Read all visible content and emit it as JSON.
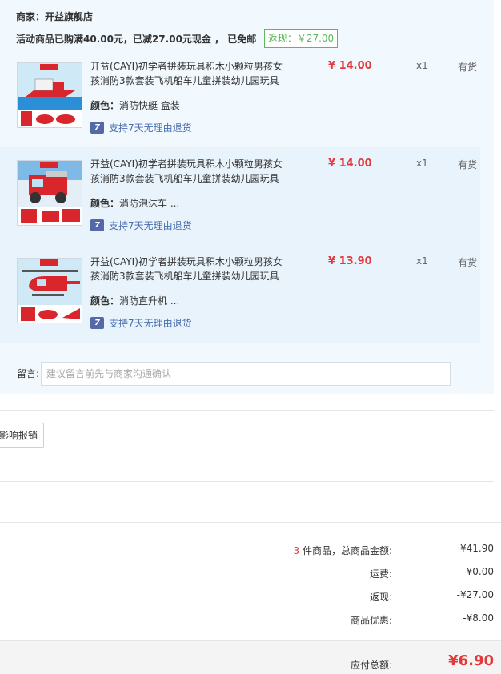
{
  "shop": {
    "name": "商家：开益旗舰店",
    "promo": "活动商品已购满40.00元，已减27.00元现金 ， 已免邮",
    "rebate_badge": "返现：￥27.00"
  },
  "items": [
    {
      "title": "开益(CAYI)初学者拼装玩具积木小颗粒男孩女孩消防3款套装飞机船车儿童拼装幼儿园玩具",
      "price": "¥ 14.00",
      "qty": "x1",
      "stock": "有货",
      "attr_label": "颜色：",
      "attr_value": "消防快艇 盒装",
      "service": "支持7天无理由退货",
      "thumb_colors": [
        "#2a8fd6",
        "#d8262c"
      ]
    },
    {
      "title": "开益(CAYI)初学者拼装玩具积木小颗粒男孩女孩消防3款套装飞机船车儿童拼装幼儿园玩具",
      "price": "¥ 14.00",
      "qty": "x1",
      "stock": "有货",
      "attr_label": "颜色：",
      "attr_value": "消防泡沫车 ...",
      "service": "支持7天无理由退货",
      "thumb_colors": [
        "#7fb9e6",
        "#d8262c"
      ]
    },
    {
      "title": "开益(CAYI)初学者拼装玩具积木小颗粒男孩女孩消防3款套装飞机船车儿童拼装幼儿园玩具",
      "price": "¥ 13.90",
      "qty": "x1",
      "stock": "有货",
      "attr_label": "颜色：",
      "attr_value": "消防直升机 ...",
      "service": "支持7天无理由退货",
      "thumb_colors": [
        "#9bd0ee",
        "#d8262c"
      ]
    }
  ],
  "memo": {
    "label": "留言:",
    "placeholder": "建议留言前先与商家沟通确认"
  },
  "reimburse_button": "影响报销",
  "summary": {
    "goods_count": "3",
    "goods_label": " 件商品，总商品金额:",
    "goods_amount": "¥41.90",
    "shipping_label": "运费:",
    "shipping_amount": "¥0.00",
    "rebate_label": "返现:",
    "rebate_amount": "-¥27.00",
    "discount_label": "商品优惠:",
    "discount_amount": "-¥8.00"
  },
  "total": {
    "label": "应付总额:",
    "amount": "¥6.90"
  },
  "colors": {
    "accent_red": "#e4393c",
    "rebate_green": "#5cb85c",
    "panel_bg": "#f1f8fe",
    "service_blue": "#4a6fad"
  }
}
